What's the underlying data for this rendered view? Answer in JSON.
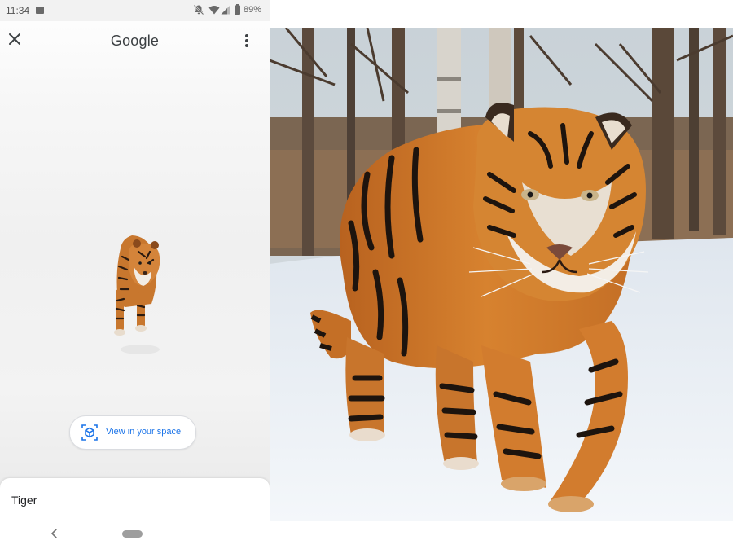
{
  "status_bar": {
    "time": "11:34",
    "battery": "89%"
  },
  "app_bar": {
    "title": "Google"
  },
  "ar_button": {
    "label": "View in your space"
  },
  "bottom_sheet": {
    "title": "Tiger"
  },
  "photo": {
    "subject": "tiger-walking-in-snow"
  }
}
